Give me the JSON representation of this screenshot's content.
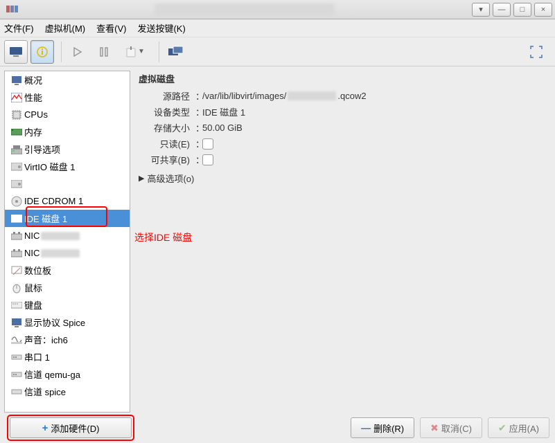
{
  "menu": {
    "file": "文件(F)",
    "vm": "虚拟机(M)",
    "view": "查看(V)",
    "sendkey": "发送按键(K)"
  },
  "sidebar": {
    "items": [
      {
        "label": "概况"
      },
      {
        "label": "性能"
      },
      {
        "label": "CPUs"
      },
      {
        "label": "内存"
      },
      {
        "label": "引导选项"
      },
      {
        "label": "VirtIO 磁盘 1"
      },
      {
        "label": ""
      },
      {
        "label": "IDE CDROM 1"
      },
      {
        "label": "IDE 磁盘 1",
        "selected": true
      },
      {
        "label": "NIC",
        "blurred": true
      },
      {
        "label": "NIC",
        "blurred": true
      },
      {
        "label": "数位板"
      },
      {
        "label": "鼠标"
      },
      {
        "label": "键盘"
      },
      {
        "label": "显示协议 Spice"
      },
      {
        "label": "声音：ich6"
      },
      {
        "label": "串口 1"
      },
      {
        "label": "信道 qemu-ga"
      },
      {
        "label": "信道 spice"
      }
    ],
    "add_hw": "添加硬件(D)"
  },
  "annotation": "选择IDE 磁盘",
  "details": {
    "heading": "虚拟磁盘",
    "rows": {
      "src_label": "源路径",
      "src_value_pre": "/var/lib/libvirt/images/",
      "src_value_post": ".qcow2",
      "type_label": "设备类型",
      "type_value": "IDE 磁盘 1",
      "size_label": "存储大小",
      "size_value": "50.00 GiB",
      "ro_label": "只读(E)",
      "share_label": "可共享(B)"
    },
    "advanced": "高级选项(o)"
  },
  "buttons": {
    "remove": "删除(R)",
    "cancel": "取消(C)",
    "apply": "应用(A)"
  }
}
